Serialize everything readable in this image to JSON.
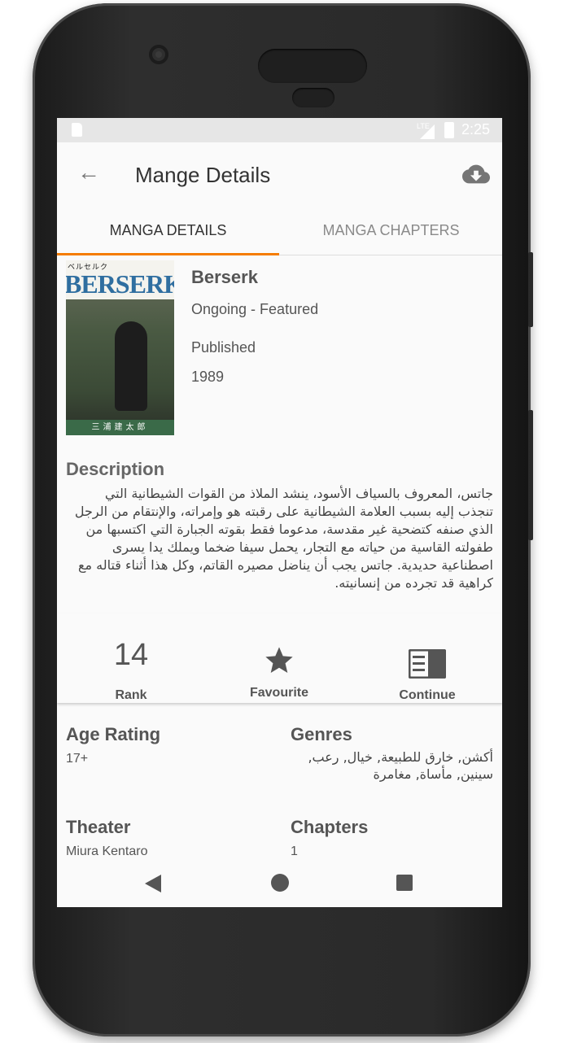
{
  "status_bar": {
    "network": "LTE",
    "time": "2:25"
  },
  "app_bar": {
    "title": "Mange Details",
    "back_icon": "arrow-back-icon",
    "download_icon": "cloud-download-icon"
  },
  "tabs": [
    {
      "label": "MANGA DETAILS",
      "selected": true
    },
    {
      "label": "MANGA CHAPTERS",
      "selected": false
    }
  ],
  "accent_color": "#f57c00",
  "manga": {
    "cover_jp_title": "ベルセルク",
    "cover_logo": "BERSERK",
    "cover_author": "三浦建太郎",
    "name": "Berserk",
    "status": "Ongoing - Featured",
    "published_label": "Published",
    "year": "1989"
  },
  "description": {
    "heading": "Description",
    "text": "جاتس، المعروف بالسياف الأسود، ينشد الملاذ من القوات الشيطانية التي تنجذب إليه بسبب العلامة الشيطانية على رقبته هو وإمراته، والإنتقام من الرجل الذي صنفه كتضحية غير مقدسة، مدعوما فقط بقوته الجبارة التي اكتسبها من طفولته القاسية من حياته مع التجار، يحمل سيفا ضخما ويملك يدا يسرى اصطناعية حديدية. جاتس يجب أن يناضل مصيره القاتم، وكل هذا أثناء قتاله مع كراهية قد تجرده من إنسانيته."
  },
  "stats": {
    "rank_value": "14",
    "rank_label": "Rank",
    "favourite_label": "Favourite",
    "favourite_icon": "star-icon",
    "continue_label": "Continue",
    "continue_icon": "book-icon"
  },
  "info": {
    "age_rating_label": "Age Rating",
    "age_rating_value": "17+",
    "genres_label": "Genres",
    "genres_value": "أكشن, خارق للطبيعة, خيال, رعب, سينين, مأساة, مغامرة",
    "theater_label": "Theater",
    "theater_value": "Miura Kentaro",
    "chapters_label": "Chapters",
    "chapters_value": "1"
  },
  "nav_bar": {
    "back_icon": "nav-back-icon",
    "home_icon": "nav-home-icon",
    "recents_icon": "nav-recents-icon"
  }
}
